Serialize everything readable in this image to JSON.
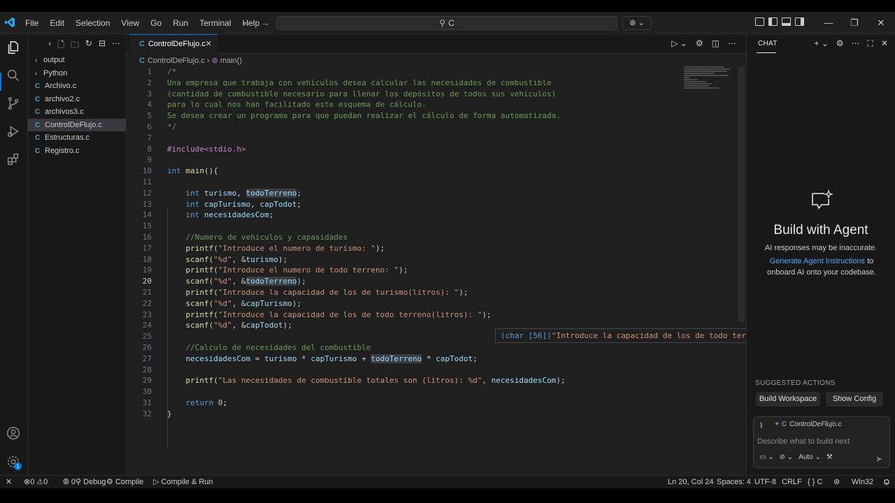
{
  "menu": [
    "File",
    "Edit",
    "Selection",
    "View",
    "Go",
    "Run",
    "Terminal",
    "Help"
  ],
  "command_center": "C",
  "explorer": {
    "items": [
      {
        "label": "output",
        "type": "folder"
      },
      {
        "label": "Python",
        "type": "folder"
      },
      {
        "label": "Archivo.c",
        "type": "c"
      },
      {
        "label": "archivo2.c",
        "type": "c"
      },
      {
        "label": "archivos3.c",
        "type": "c"
      },
      {
        "label": "ControlDeFlujo.c",
        "type": "c",
        "selected": true
      },
      {
        "label": "Estructuras.c",
        "type": "c"
      },
      {
        "label": "Registro.c",
        "type": "c"
      }
    ]
  },
  "editor": {
    "tab_label": "ControlDeFlujo.c",
    "breadcrumb_file": "ControlDeFlujo.c",
    "breadcrumb_symbol": "main()",
    "current_line": 20,
    "lines": [
      "/*",
      "Una empresa que trabaja con vehículos desea calcular las necesidades de combustible",
      "(cantidad de combustible necesario para llenar los depósitos de todos sus vehículos)",
      "para lo cual nos han facilitado este esquema de cálculo.",
      "Se desea crear un programa para que puedan realizar el cálculo de forma automatizada.",
      "*/",
      "",
      "#include<stdio.h>",
      "",
      "int main(){",
      "",
      "    int turismo, todoTerreno;",
      "    int capTurismo, capTodot;",
      "    int necesidadesCom;",
      "",
      "    //Numero de vehiculos y capasidades",
      "    printf(\"Introduce el numero de turismo: \");",
      "    scanf(\"%d\", &turismo);",
      "    printf(\"Introduce el numero de todo terreno: \");",
      "    scanf(\"%d\", &todoTerreno);",
      "    printf(\"Introduce la capacidad de los de turismo(litros): \");",
      "    scanf(\"%d\", &capTurismo);",
      "    printf(\"Introduce la capacidad de los de todo terreno(litros): \");",
      "    scanf(\"%d\", &capTodot);",
      "",
      "    //Calculo de necesidades del combustible",
      "    necesidadesCom = turismo * capTurismo + todoTerreno * capTodot;",
      "",
      "    printf(\"Las necesidades de combustible totales son (litros): %d\", necesidadesCom);",
      "",
      "    return 0;",
      "}"
    ],
    "hover_type": "(char [56])",
    "hover_value": "\"Introduce la capacidad de los de todo terreno(litros): \""
  },
  "chat": {
    "header": "CHAT",
    "title": "Build with Agent",
    "disclaimer": "AI responses may be inaccurate.",
    "link": "Generate Agent Instructions",
    "link_suffix": " to",
    "onboard_text": "onboard AI onto your codebase.",
    "suggested_label": "SUGGESTED ACTIONS",
    "actions": [
      "Build Workspace",
      "Show Config"
    ],
    "context_file": "ControlDeFlujo.c",
    "input_placeholder": "Describe what to build next",
    "mode": "Auto"
  },
  "status": {
    "errors": "0",
    "warnings": "0",
    "ports": "0",
    "debug": "Debug",
    "compile": "Compile",
    "compile_run": "Compile & Run",
    "position": "Ln 20, Col 24",
    "spaces": "Spaces: 4",
    "encoding": "UTF-8",
    "eol": "CRLF",
    "language": "C",
    "platform": "Win32"
  },
  "notification_badge": "1",
  "colors": {
    "accent": "#0078d4",
    "comment": "#6a9955",
    "keyword": "#569cd6",
    "string": "#ce9178",
    "function": "#dcdcaa",
    "variable": "#9cdcfe",
    "preprocessor": "#c586c0"
  }
}
